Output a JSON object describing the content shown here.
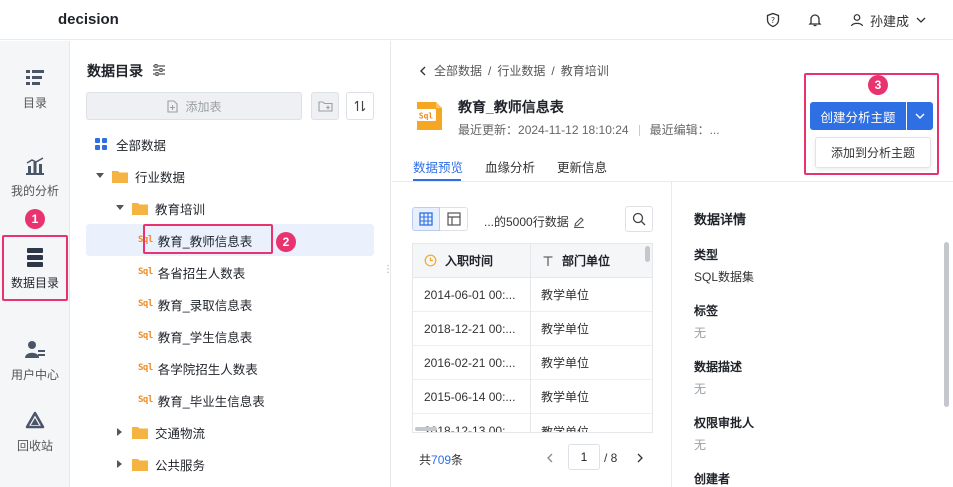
{
  "app": {
    "brand": "decision",
    "user_name": "孙建成"
  },
  "nav": {
    "items": [
      {
        "key": "catalog",
        "label": "目录"
      },
      {
        "key": "my-analysis",
        "label": "我的分析"
      },
      {
        "key": "data-catalog",
        "label": "数据目录"
      },
      {
        "key": "user-center",
        "label": "用户中心"
      },
      {
        "key": "recycle",
        "label": "回收站"
      }
    ]
  },
  "tree": {
    "title": "数据目录",
    "add_table_label": "添加表",
    "rows": [
      {
        "label": "全部数据",
        "type": "all"
      },
      {
        "label": "行业数据",
        "type": "folder"
      },
      {
        "label": "教育培训",
        "type": "folder"
      },
      {
        "label": "教育_教师信息表",
        "type": "sql",
        "badge": "Sql"
      },
      {
        "label": "各省招生人数表",
        "type": "sql",
        "badge": "Sql"
      },
      {
        "label": "教育_录取信息表",
        "type": "sql",
        "badge": "Sql"
      },
      {
        "label": "教育_学生信息表",
        "type": "sql",
        "badge": "Sql"
      },
      {
        "label": "各学院招生人数表",
        "type": "sql",
        "badge": "Sql"
      },
      {
        "label": "教育_毕业生信息表",
        "type": "sql",
        "badge": "Sql"
      },
      {
        "label": "交通物流",
        "type": "folder"
      },
      {
        "label": "公共服务",
        "type": "folder"
      }
    ]
  },
  "markers": {
    "m1": "1",
    "m2": "2",
    "m3": "3"
  },
  "main": {
    "breadcrumb": [
      "全部数据",
      "行业数据",
      "教育培训"
    ],
    "breadcrumb_sep": "/",
    "dataset_title": "教育_教师信息表",
    "last_update_label": "最近更新：",
    "last_update_value": "2024-11-12 18:10:24",
    "last_edit_label": "最近编辑：...",
    "create_button": "创建分析主题",
    "dropdown_item": "添加到分析主题",
    "tabs": [
      "数据预览",
      "血缘分析",
      "更新信息"
    ]
  },
  "preview": {
    "label": "...的5000行数据",
    "columns": [
      "入职时间",
      "部门单位"
    ],
    "rows": [
      [
        "2014-06-01 00:...",
        "教学单位"
      ],
      [
        "2018-12-21 00:...",
        "教学单位"
      ],
      [
        "2016-02-21 00:...",
        "教学单位"
      ],
      [
        "2015-06-14 00:...",
        "教学单位"
      ],
      [
        "2018-12-13 00:...",
        "教学单位"
      ]
    ],
    "total_prefix": "共",
    "total_count": "709",
    "total_suffix": "条",
    "current_page": "1",
    "total_pages": "/ 8"
  },
  "details": {
    "title": "数据详情",
    "fields": [
      {
        "label": "类型",
        "value": "SQL数据集"
      },
      {
        "label": "标签",
        "value": "无"
      },
      {
        "label": "数据描述",
        "value": "无"
      },
      {
        "label": "权限审批人",
        "value": "无"
      },
      {
        "label": "创建者",
        "value": ""
      }
    ]
  },
  "colors": {
    "accent": "#2f6fe4",
    "highlight": "#e8336f",
    "sql_badge": "#f08a24",
    "folder": "#f5b342"
  }
}
